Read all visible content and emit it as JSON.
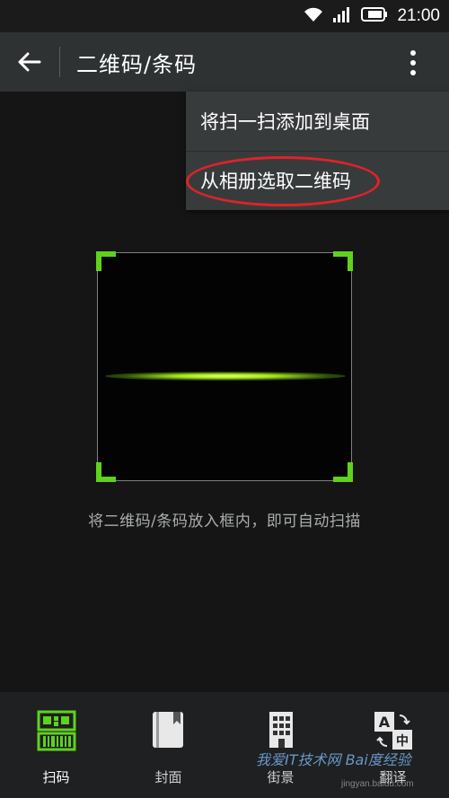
{
  "status_bar": {
    "time": "21:00"
  },
  "toolbar": {
    "title": "二维码/条码"
  },
  "menu": {
    "items": [
      {
        "label": "将扫一扫添加到桌面"
      },
      {
        "label": "从相册选取二维码",
        "highlighted": true
      }
    ]
  },
  "scanner": {
    "hint": "将二维码/条码放入框内，即可自动扫描",
    "accent_color": "#5fd21d"
  },
  "tabs": [
    {
      "label": "扫码",
      "icon": "qr-barcode-icon",
      "active": true
    },
    {
      "label": "封面",
      "icon": "book-cover-icon",
      "active": false
    },
    {
      "label": "街景",
      "icon": "street-view-icon",
      "active": false
    },
    {
      "label": "翻译",
      "icon": "translate-icon",
      "active": false
    }
  ],
  "watermark": {
    "text": "我爱IT技术网 Bai度经验",
    "url": "jingyan.baidu.com"
  }
}
